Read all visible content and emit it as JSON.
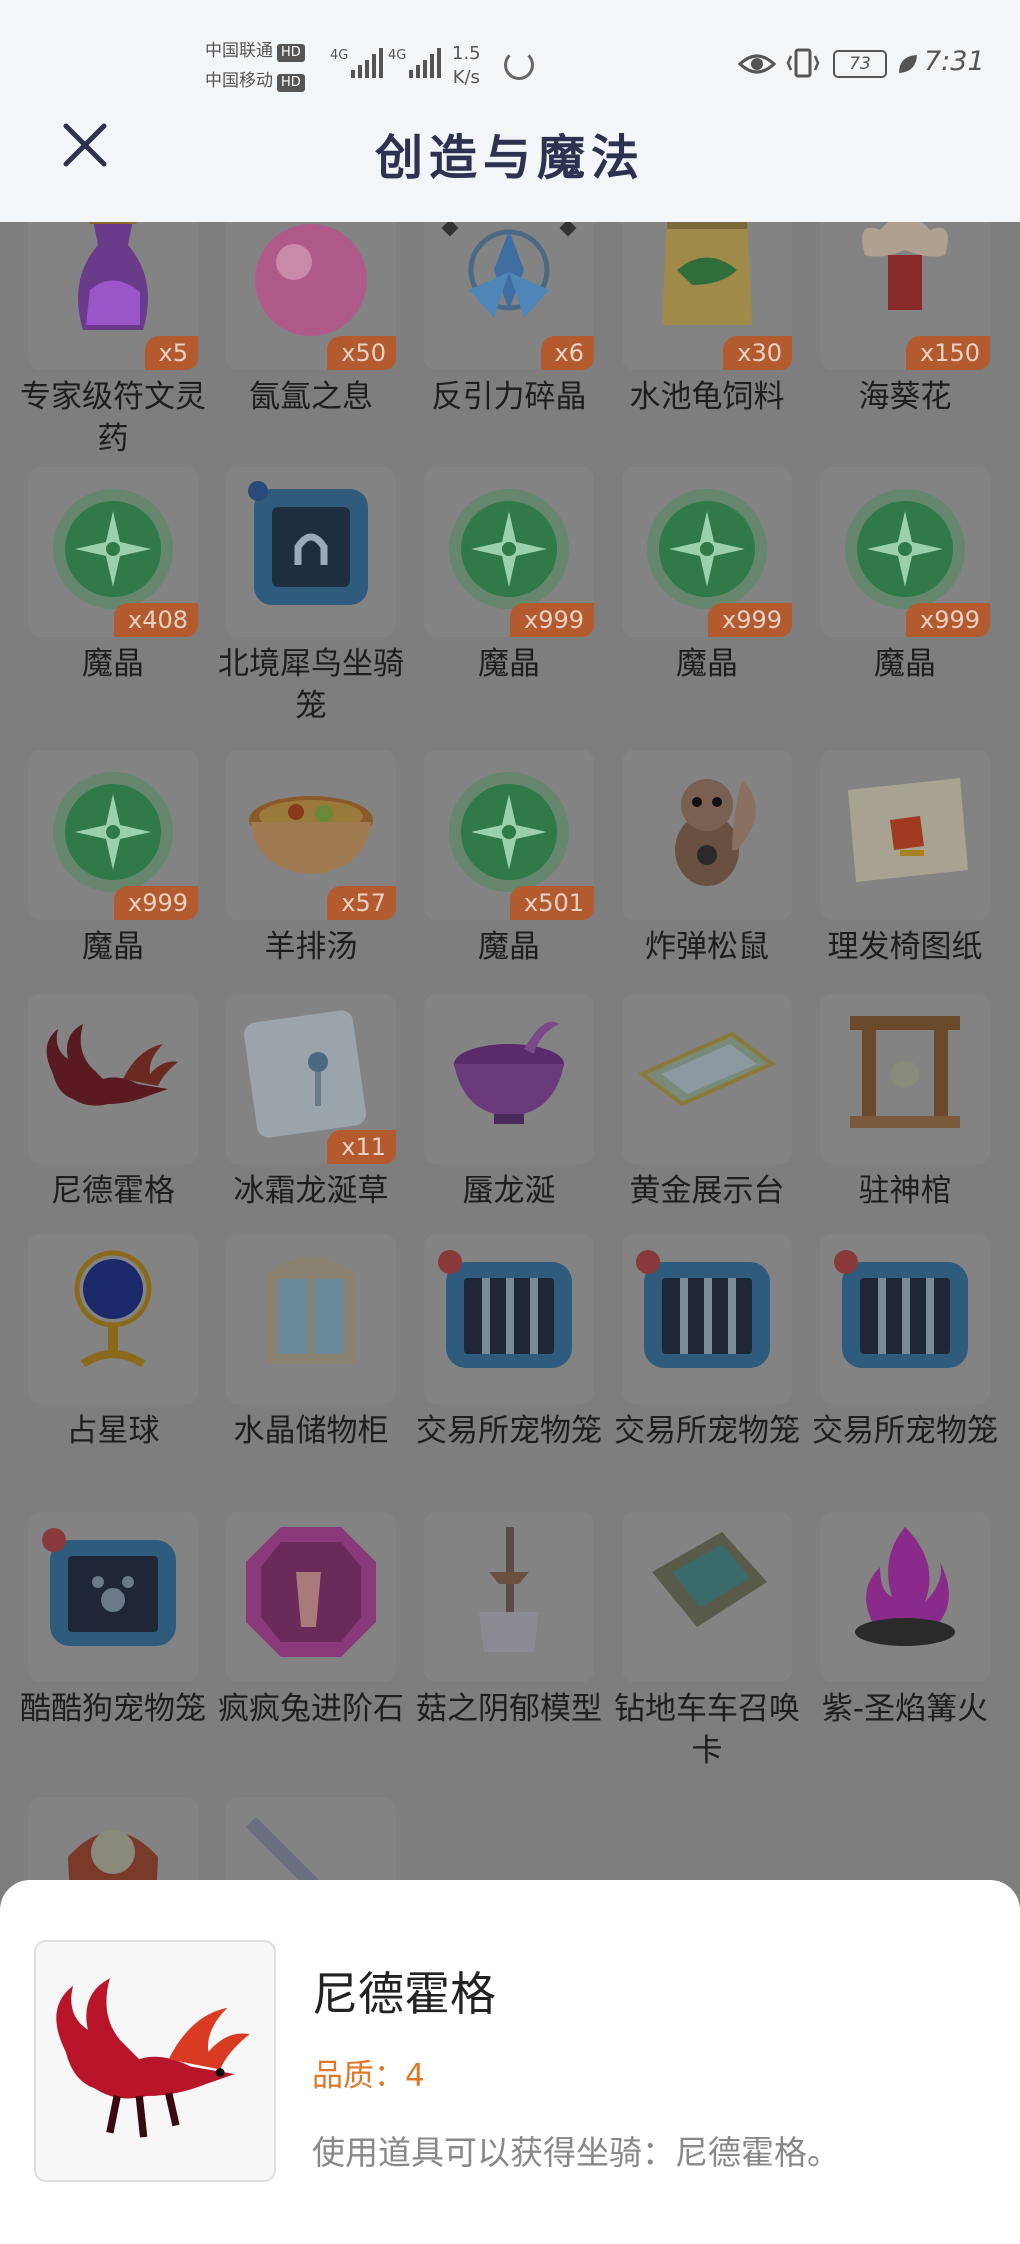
{
  "status_bar": {
    "carrier1": "中国联通",
    "carrier2": "中国移动",
    "hd": "HD",
    "net1": "4G",
    "net2": "4G",
    "speed_value": "1.5",
    "speed_unit": "K/s",
    "battery": "73",
    "time": "7:31"
  },
  "header": {
    "title": "创造与魔法"
  },
  "items": [
    {
      "name": "专家级符文灵药",
      "qty": "x5",
      "icon": "purple-potion-icon"
    },
    {
      "name": "氤氲之息",
      "qty": "x50",
      "icon": "pink-orb-icon"
    },
    {
      "name": "反引力碎晶",
      "qty": "x6",
      "icon": "antigravity-crystal-icon"
    },
    {
      "name": "水池龟饲料",
      "qty": "x30",
      "icon": "turtle-feed-bag-icon"
    },
    {
      "name": "海葵花",
      "qty": "x150",
      "icon": "anemone-flower-icon"
    },
    {
      "name": "魔晶",
      "qty": "x408",
      "icon": "magic-crystal-icon"
    },
    {
      "name": "北境犀鸟坐骑笼",
      "qty": "",
      "icon": "mount-cage-icon"
    },
    {
      "name": "魔晶",
      "qty": "x999",
      "icon": "magic-crystal-icon"
    },
    {
      "name": "魔晶",
      "qty": "x999",
      "icon": "magic-crystal-icon"
    },
    {
      "name": "魔晶",
      "qty": "x999",
      "icon": "magic-crystal-icon"
    },
    {
      "name": "魔晶",
      "qty": "x999",
      "icon": "magic-crystal-icon"
    },
    {
      "name": "羊排汤",
      "qty": "x57",
      "icon": "lamb-soup-icon"
    },
    {
      "name": "魔晶",
      "qty": "x501",
      "icon": "magic-crystal-icon"
    },
    {
      "name": "炸弹松鼠",
      "qty": "",
      "icon": "bomb-squirrel-icon"
    },
    {
      "name": "理发椅图纸",
      "qty": "",
      "icon": "blueprint-scroll-icon"
    },
    {
      "name": "尼德霍格",
      "qty": "",
      "icon": "dragon-mount-icon"
    },
    {
      "name": "冰霜龙涎草",
      "qty": "x11",
      "icon": "frost-herb-icon"
    },
    {
      "name": "蜃龙涎",
      "qty": "",
      "icon": "purple-bowl-icon"
    },
    {
      "name": "黄金展示台",
      "qty": "",
      "icon": "display-platform-icon"
    },
    {
      "name": "驻神棺",
      "qty": "",
      "icon": "shrine-gate-icon"
    },
    {
      "name": "占星球",
      "qty": "",
      "icon": "astrology-globe-icon"
    },
    {
      "name": "水晶储物柜",
      "qty": "",
      "icon": "crystal-cabinet-icon"
    },
    {
      "name": "交易所宠物笼",
      "qty": "",
      "icon": "pet-cage-icon"
    },
    {
      "name": "交易所宠物笼",
      "qty": "",
      "icon": "pet-cage-icon"
    },
    {
      "name": "交易所宠物笼",
      "qty": "",
      "icon": "pet-cage-icon"
    },
    {
      "name": "酷酷狗宠物笼",
      "qty": "",
      "icon": "dog-pet-cage-icon"
    },
    {
      "name": "疯疯兔进阶石",
      "qty": "",
      "icon": "rabbit-advance-stone-icon"
    },
    {
      "name": "菇之阴郁模型",
      "qty": "",
      "icon": "sword-model-icon"
    },
    {
      "name": "钻地车车召唤卡",
      "qty": "",
      "icon": "summon-card-icon"
    },
    {
      "name": "紫-圣焰篝火",
      "qty": "",
      "icon": "purple-bonfire-icon"
    },
    {
      "name": "",
      "qty": "",
      "icon": "armor-figure-icon"
    },
    {
      "name": "",
      "qty": "",
      "icon": "blade-icon"
    }
  ],
  "detail": {
    "name": "尼德霍格",
    "quality": "品质：4",
    "description": "使用道具可以获得坐骑：尼德霍格。",
    "icon": "dragon-mount-icon"
  },
  "colors": {
    "header_bg": "#f3f6f9",
    "title": "#2c3250",
    "qty_badge": "#b35a2e",
    "quality": "#e0782c",
    "overlay": "#7e7e7e"
  }
}
